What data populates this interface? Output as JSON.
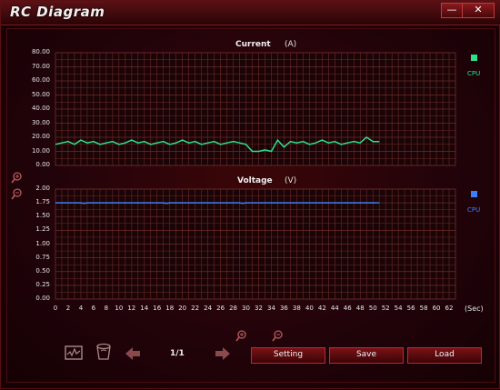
{
  "window": {
    "title": "RC Diagram",
    "minimize_label": "—",
    "close_label": "✕"
  },
  "colors": {
    "current_line": "#2ee08a",
    "voltage_line": "#3b7fff",
    "grid": "#6e2a2c",
    "accent_red": "#b52c31"
  },
  "x_axis": {
    "ticks": [
      "0",
      "2",
      "4",
      "6",
      "8",
      "10",
      "12",
      "14",
      "16",
      "18",
      "20",
      "22",
      "24",
      "26",
      "28",
      "30",
      "32",
      "34",
      "36",
      "38",
      "40",
      "42",
      "44",
      "46",
      "48",
      "50",
      "52",
      "54",
      "56",
      "58",
      "60",
      "62"
    ],
    "unit": "(Sec)"
  },
  "chart_data": [
    {
      "type": "line",
      "title": "Current",
      "unit": "(A)",
      "ylim": [
        0,
        80
      ],
      "yticks": [
        "80.00",
        "70.00",
        "60.00",
        "50.00",
        "40.00",
        "30.00",
        "20.00",
        "10.00",
        "0.00"
      ],
      "xlim": [
        0,
        63
      ],
      "grid": true,
      "legend": "right",
      "series": [
        {
          "name": "CPU",
          "color": "#2ee08a",
          "x": [
            0,
            1,
            2,
            3,
            4,
            5,
            6,
            7,
            8,
            9,
            10,
            11,
            12,
            13,
            14,
            15,
            16,
            17,
            18,
            19,
            20,
            21,
            22,
            23,
            24,
            25,
            26,
            27,
            28,
            29,
            30,
            31,
            32,
            33,
            34,
            35,
            36,
            37,
            38,
            39,
            40,
            41,
            42,
            43,
            44,
            45,
            46,
            47,
            48,
            49,
            50,
            51
          ],
          "y": [
            15,
            16,
            17,
            15,
            18,
            16,
            17,
            15,
            16,
            17,
            15,
            16,
            18,
            16,
            17,
            15,
            16,
            17,
            15,
            16,
            18,
            16,
            17,
            15,
            16,
            17,
            15,
            16,
            17,
            16,
            15,
            10,
            10,
            11,
            10,
            18,
            13,
            17,
            16,
            17,
            15,
            16,
            18,
            16,
            17,
            15,
            16,
            17,
            16,
            20,
            17,
            17
          ]
        }
      ]
    },
    {
      "type": "line",
      "title": "Voltage",
      "unit": "(V)",
      "ylim": [
        0,
        2
      ],
      "yticks": [
        "2.00",
        "1.75",
        "1.50",
        "1.25",
        "1.00",
        "0.75",
        "0.50",
        "0.25",
        "0.00"
      ],
      "xlim": [
        0,
        63
      ],
      "grid": true,
      "legend": "right",
      "series": [
        {
          "name": "CPU",
          "color": "#3b7fff",
          "x": [
            0,
            4,
            4.5,
            5,
            10,
            17,
            17.5,
            18,
            25,
            29,
            29.5,
            30,
            35,
            40,
            45,
            51
          ],
          "y": [
            1.75,
            1.75,
            1.74,
            1.75,
            1.75,
            1.75,
            1.74,
            1.75,
            1.75,
            1.75,
            1.74,
            1.75,
            1.75,
            1.75,
            1.75,
            1.75
          ]
        }
      ]
    }
  ],
  "toolbar": {
    "page_indicator": "1/1",
    "setting_label": "Setting",
    "save_label": "Save",
    "load_label": "Load",
    "icons": [
      "chart-icon",
      "trash-icon",
      "prev-arrow-icon",
      "next-arrow-icon",
      "zoom-in-icon",
      "zoom-out-icon"
    ]
  }
}
